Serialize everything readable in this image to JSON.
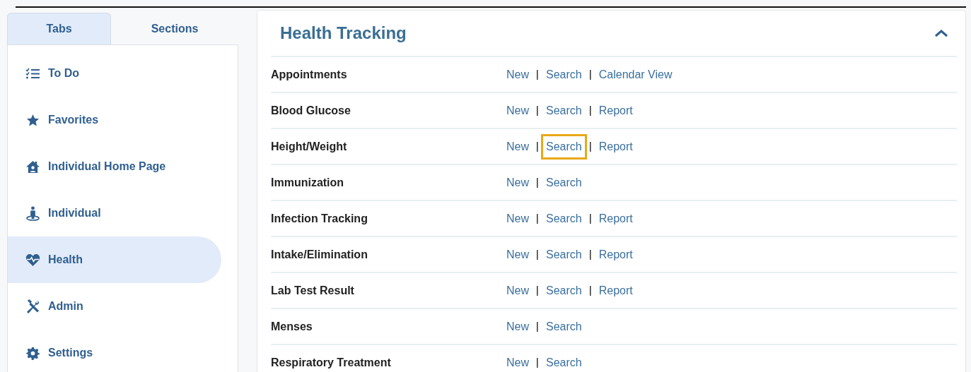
{
  "side_tabs": [
    {
      "label": "Tabs",
      "selected": true
    },
    {
      "label": "Sections",
      "selected": false
    }
  ],
  "nav_items": [
    {
      "label": "To Do",
      "selected": false
    },
    {
      "label": "Favorites",
      "selected": false
    },
    {
      "label": "Individual Home Page",
      "selected": false
    },
    {
      "label": "Individual",
      "selected": false
    },
    {
      "label": "Health",
      "selected": true
    },
    {
      "label": "Admin",
      "selected": false
    },
    {
      "label": "Settings",
      "selected": false
    }
  ],
  "section": {
    "title": "Health Tracking",
    "expanded": true,
    "rows": [
      {
        "label": "Appointments",
        "links": [
          {
            "text": "New",
            "focused": false
          },
          {
            "text": "Search",
            "focused": false
          },
          {
            "text": "Calendar View",
            "focused": false
          }
        ]
      },
      {
        "label": "Blood Glucose",
        "links": [
          {
            "text": "New",
            "focused": false
          },
          {
            "text": "Search",
            "focused": false
          },
          {
            "text": "Report",
            "focused": false
          }
        ]
      },
      {
        "label": "Height/Weight",
        "links": [
          {
            "text": "New",
            "focused": false
          },
          {
            "text": "Search",
            "focused": true
          },
          {
            "text": "Report",
            "focused": false
          }
        ]
      },
      {
        "label": "Immunization",
        "links": [
          {
            "text": "New",
            "focused": false
          },
          {
            "text": "Search",
            "focused": false
          }
        ]
      },
      {
        "label": "Infection Tracking",
        "links": [
          {
            "text": "New",
            "focused": false
          },
          {
            "text": "Search",
            "focused": false
          },
          {
            "text": "Report",
            "focused": false
          }
        ]
      },
      {
        "label": "Intake/Elimination",
        "links": [
          {
            "text": "New",
            "focused": false
          },
          {
            "text": "Search",
            "focused": false
          },
          {
            "text": "Report",
            "focused": false
          }
        ]
      },
      {
        "label": "Lab Test Result",
        "links": [
          {
            "text": "New",
            "focused": false
          },
          {
            "text": "Search",
            "focused": false
          },
          {
            "text": "Report",
            "focused": false
          }
        ]
      },
      {
        "label": "Menses",
        "links": [
          {
            "text": "New",
            "focused": false
          },
          {
            "text": "Search",
            "focused": false
          }
        ]
      },
      {
        "label": "Respiratory Treatment",
        "links": [
          {
            "text": "New",
            "focused": false
          },
          {
            "text": "Search",
            "focused": false
          }
        ]
      }
    ]
  }
}
